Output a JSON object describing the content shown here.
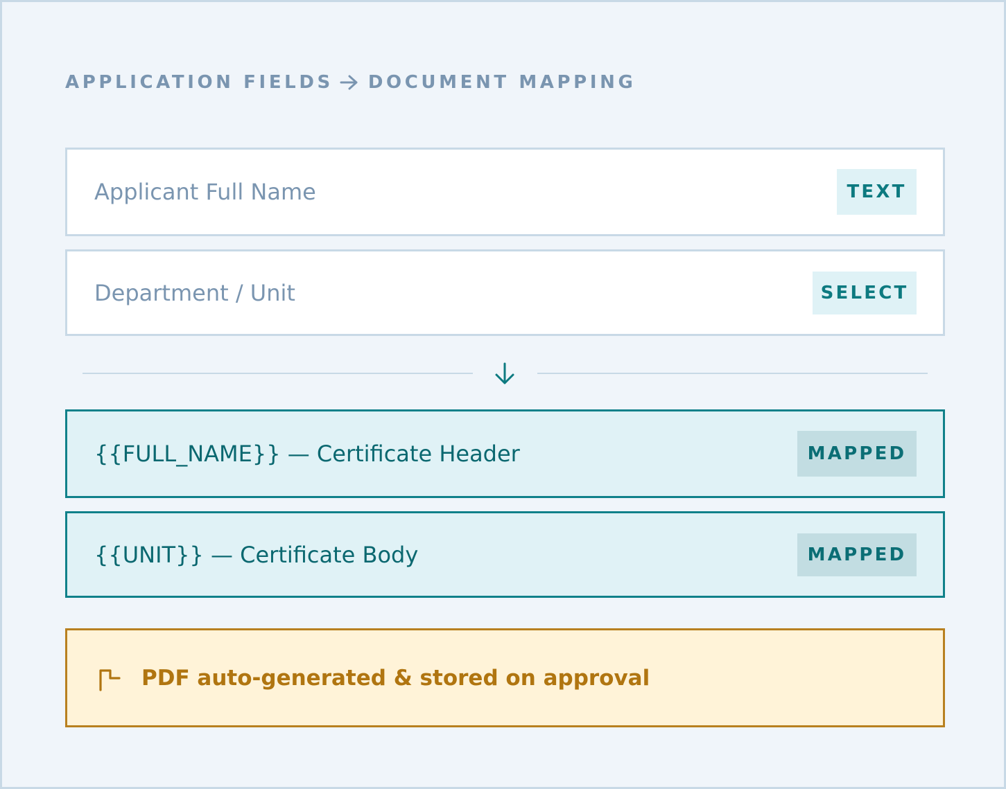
{
  "heading": {
    "left": "APPLICATION FIELDS",
    "arrow_icon": "arrow-right-icon",
    "right": "DOCUMENT MAPPING"
  },
  "source_fields": [
    {
      "label": "Applicant Full Name",
      "type": "TEXT"
    },
    {
      "label": "Department / Unit",
      "type": "SELECT"
    }
  ],
  "divider": {
    "icon": "arrow-down-icon"
  },
  "mappings": [
    {
      "label": "{{FULL_NAME}} — Certificate Header",
      "status": "MAPPED"
    },
    {
      "label": "{{UNIT}} — Certificate Body",
      "status": "MAPPED"
    }
  ],
  "note": {
    "icon": "document-corner-icon",
    "text": "PDF auto-generated & stored on approval"
  },
  "colors": {
    "background": "#f0f5fa",
    "border": "#c8d9e6",
    "muted_text": "#7a95b0",
    "teal": "#10818a",
    "teal_fill": "#e0f2f6",
    "amber": "#b07510",
    "amber_fill": "#fff3d8"
  }
}
